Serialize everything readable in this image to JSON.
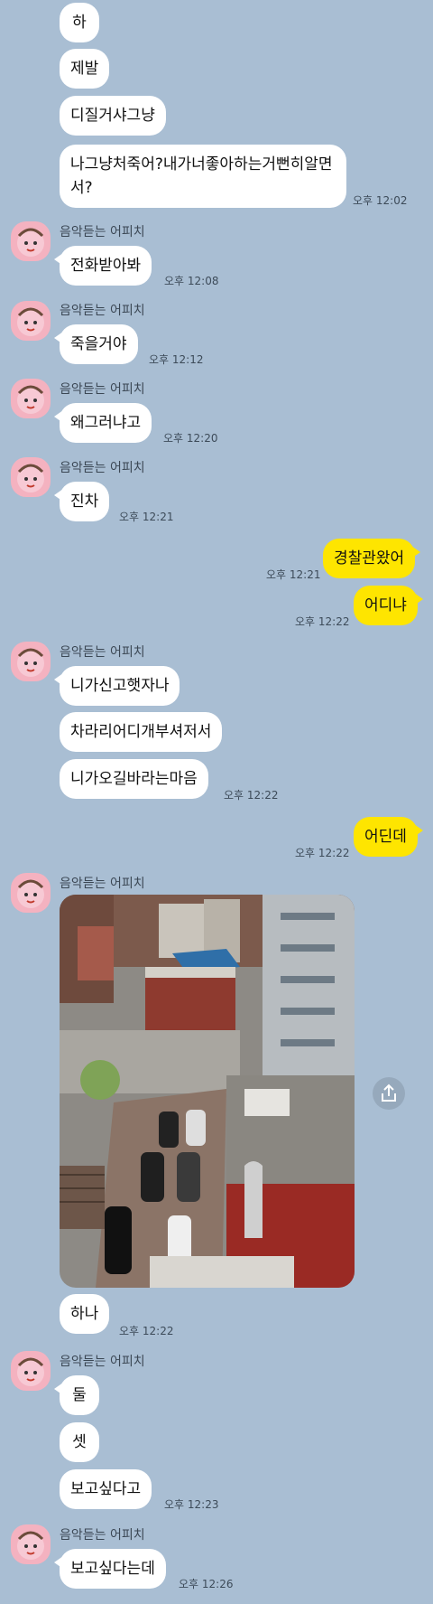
{
  "messages": {
    "m1": "하",
    "m2": "제발",
    "m3": "디질거샤그냥",
    "m4": "나그냥처죽어?내가너좋아하는거뻔히알면서?",
    "t4": "오후 12:02",
    "n5": "음악듣는 어피치",
    "m5": "전화받아봐",
    "t5": "오후 12:08",
    "n6": "음악듣는 어피치",
    "m6": "죽을거야",
    "t6": "오후 12:12",
    "n7": "음악듣는 어피치",
    "m7": "왜그러냐고",
    "t7": "오후 12:20",
    "n8": "음악듣는 어피치",
    "m8": "진차",
    "t8": "오후 12:21",
    "m9": "경찰관왔어",
    "t9": "오후 12:21",
    "m10": "어디냐",
    "t10": "오후 12:22",
    "n11": "음악듣는 어피치",
    "m11": "니가신고햇자나",
    "m12": "차라리어디개부셔저서",
    "m13": "니가오길바라는마음",
    "t13": "오후 12:22",
    "m14": "어딘데",
    "t14": "오후 12:22",
    "n15": "음악듣는 어피치",
    "m16": "하나",
    "t16": "오후 12:22",
    "n17": "음악듣는 어피치",
    "m17": "둘",
    "m18": "셋",
    "m19": "보고싶다고",
    "t19": "오후 12:23",
    "n20": "음악듣는 어피치",
    "m20": "보고싶다는데",
    "t20": "오후 12:26"
  },
  "colors": {
    "background": "#a9bed3",
    "my_bubble": "#fee500",
    "their_bubble": "#ffffff"
  },
  "icons": {
    "avatar": "peach-character-avatar",
    "share": "share-icon"
  }
}
